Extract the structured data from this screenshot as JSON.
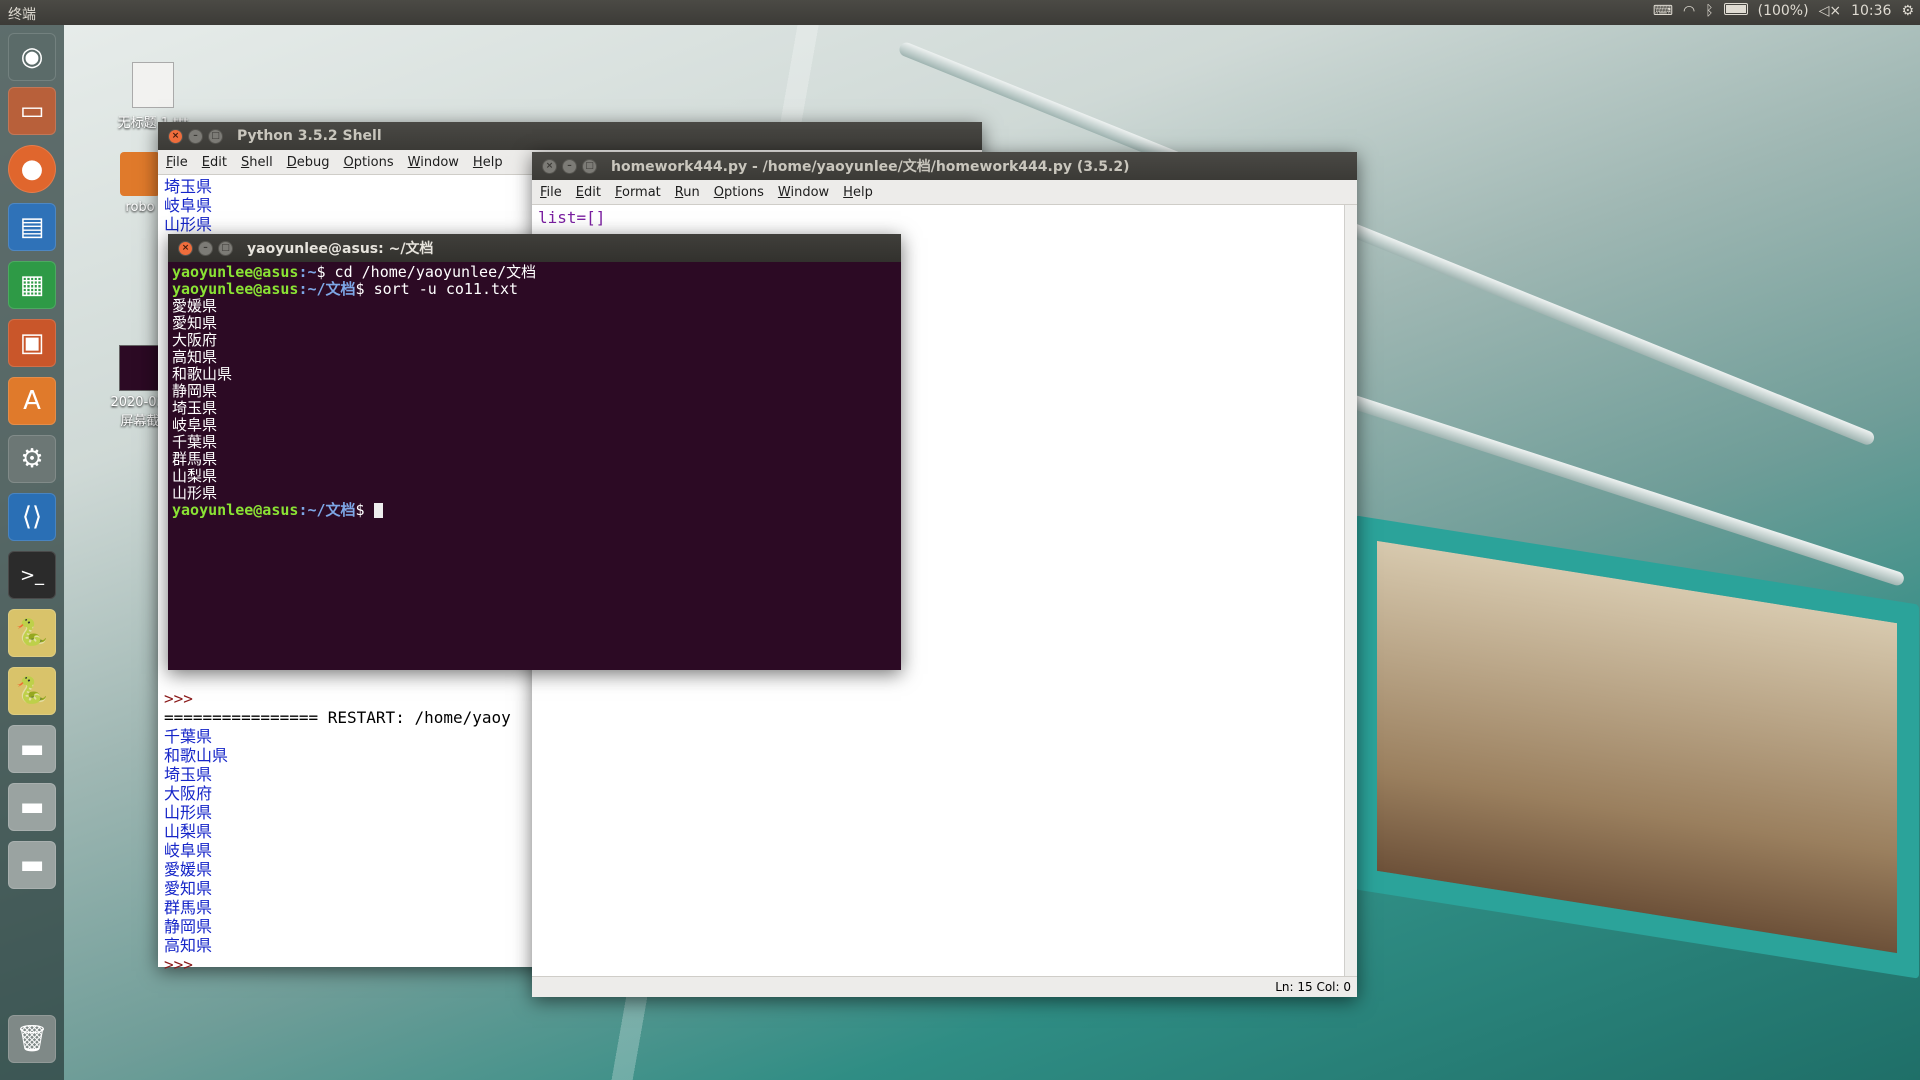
{
  "top_panel": {
    "app_title": "终端",
    "battery_text": "(100%)",
    "clock": "10:36",
    "icons": [
      "keyboard-icon",
      "wifi-icon",
      "bluetooth-icon",
      "battery-icon",
      "volume-muted-icon",
      "settings-gear-icon"
    ]
  },
  "launcher": {
    "items": [
      "ubuntu-dash-icon",
      "files-icon",
      "firefox-icon",
      "writer-icon",
      "calc-icon",
      "impress-icon",
      "software-center-icon",
      "system-settings-icon",
      "vscode-icon",
      "terminal-icon",
      "idle-python-icon",
      "idle-python-icon",
      "drive-icon",
      "drive-icon",
      "drive-icon",
      "trash-icon"
    ]
  },
  "desktop": {
    "icons": [
      {
        "label": "无标题 1.ttt"
      },
      {
        "label": "robo"
      },
      {
        "label": "2020-03-"
      },
      {
        "label": "屏幕截"
      }
    ]
  },
  "python_shell": {
    "title": "Python 3.5.2 Shell",
    "menu": [
      "File",
      "Edit",
      "Shell",
      "Debug",
      "Options",
      "Window",
      "Help"
    ],
    "top_lines": [
      "埼玉県",
      "岐阜県",
      "山形県"
    ],
    "prompt_mid": ">>>",
    "restart_line": "================ RESTART: /home/yaoy",
    "bottom_lines": [
      "千葉県",
      "和歌山県",
      "埼玉県",
      "大阪府",
      "山形県",
      "山梨県",
      "岐阜県",
      "愛媛県",
      "愛知県",
      "群馬県",
      "静岡県",
      "高知県"
    ],
    "prompt": ">>>"
  },
  "editor": {
    "title": "homework444.py - /home/yaoyunlee/文档/homework444.py (3.5.2)",
    "menu": [
      "File",
      "Edit",
      "Format",
      "Run",
      "Options",
      "Window",
      "Help"
    ],
    "code_first_line": "list=[]",
    "status": "Ln: 15   Col: 0"
  },
  "terminal": {
    "title": "yaoyunlee@asus: ~/文档",
    "line1": {
      "user": "yaoyunlee@asus",
      "path": ":~",
      "cmd": "$ cd /home/yaoyunlee/文档"
    },
    "line2": {
      "user": "yaoyunlee@asus",
      "path": ":~/文档",
      "cmd": "$ sort -u co11.txt"
    },
    "output": [
      "愛媛県",
      "愛知県",
      "大阪府",
      "高知県",
      "和歌山県",
      "静岡県",
      "埼玉県",
      "岐阜県",
      "千葉県",
      "群馬県",
      "山梨県",
      "山形県"
    ],
    "line_last": {
      "user": "yaoyunlee@asus",
      "path": ":~/文档",
      "cmd": "$ "
    }
  }
}
